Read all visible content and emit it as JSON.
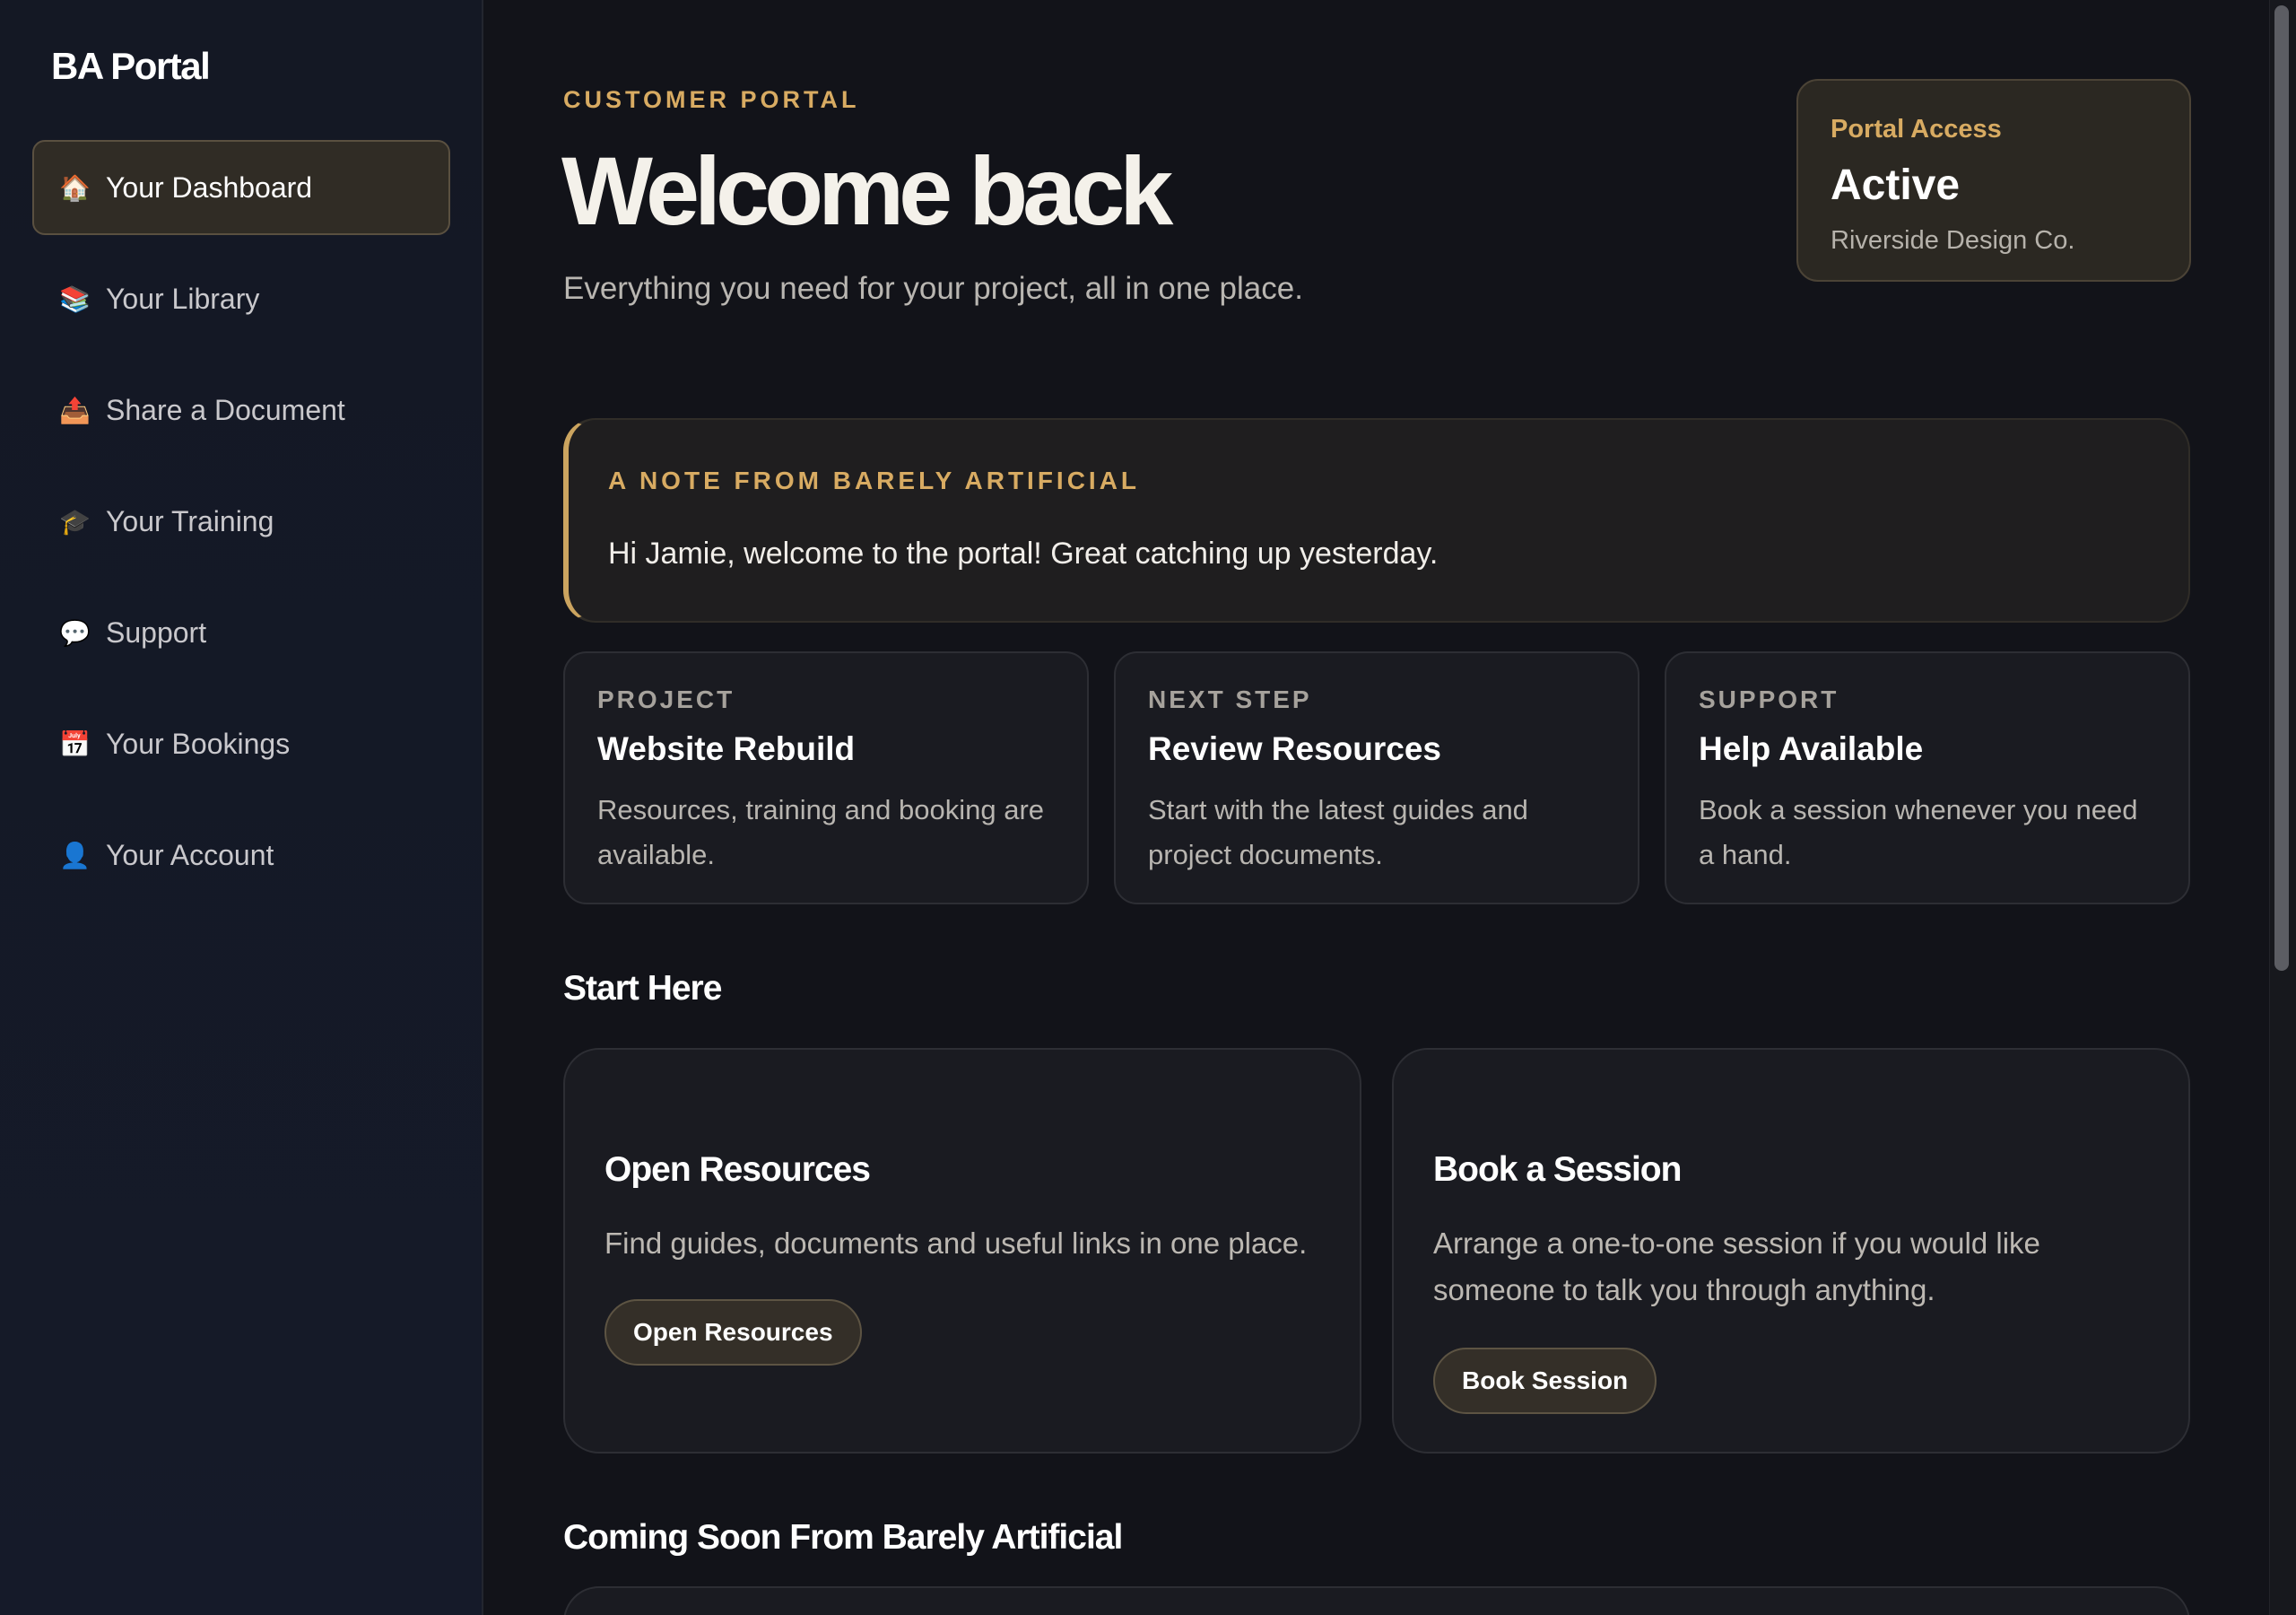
{
  "sidebar": {
    "brand": "BA Portal",
    "items": [
      {
        "icon": "🏠",
        "label": "Your Dashboard",
        "active": true
      },
      {
        "icon": "📚",
        "label": "Your Library"
      },
      {
        "icon": "📤",
        "label": "Share a Document"
      },
      {
        "icon": "🎓",
        "label": "Your Training"
      },
      {
        "icon": "💬",
        "label": "Support"
      },
      {
        "icon": "📅",
        "label": "Your Bookings"
      },
      {
        "icon": "👤",
        "label": "Your Account"
      }
    ]
  },
  "header": {
    "eyebrow": "CUSTOMER PORTAL",
    "title": "Welcome back",
    "subtitle": "Everything you need for your project, all in one place."
  },
  "access": {
    "label": "Portal Access",
    "status": "Active",
    "company": "Riverside Design Co."
  },
  "note": {
    "label": "A NOTE FROM BARELY ARTIFICIAL",
    "text": "Hi Jamie, welcome to the portal! Great catching up yesterday."
  },
  "info_cards": [
    {
      "label": "PROJECT",
      "title": "Website Rebuild",
      "text": "Resources, training and booking are available."
    },
    {
      "label": "NEXT STEP",
      "title": "Review Resources",
      "text": "Start with the latest guides and project documents."
    },
    {
      "label": "SUPPORT",
      "title": "Help Available",
      "text": "Book a session whenever you need a hand."
    }
  ],
  "start_here": {
    "title": "Start Here",
    "cards": [
      {
        "title": "Open Resources",
        "text": "Find guides, documents and useful links in one place.",
        "button": "Open Resources"
      },
      {
        "title": "Book a Session",
        "text": "Arrange a one-to-one session if you would like someone to talk you through anything.",
        "button": "Book Session"
      }
    ]
  },
  "coming_soon": {
    "title": "Coming Soon From Barely Artificial"
  },
  "colors": {
    "accent": "#d8ab62",
    "background": "#121319",
    "sidebar": "#151a29"
  }
}
